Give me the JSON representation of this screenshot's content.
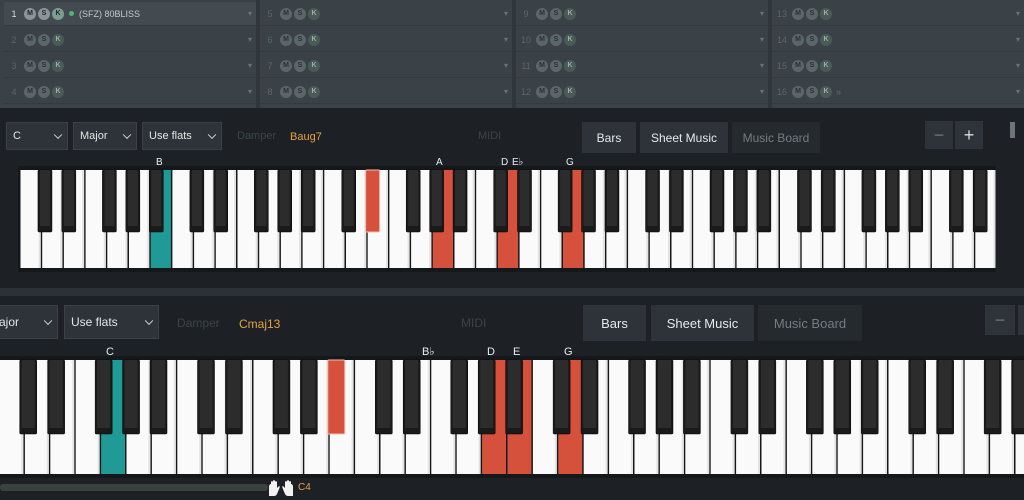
{
  "tracks": [
    {
      "num": "1",
      "name": "(SFZ) 80BLISS",
      "active": true
    },
    {
      "num": "2",
      "name": "",
      "active": false
    },
    {
      "num": "3",
      "name": "",
      "active": false
    },
    {
      "num": "4",
      "name": "",
      "active": false
    },
    {
      "num": "5",
      "name": "",
      "active": false
    },
    {
      "num": "6",
      "name": "",
      "active": false
    },
    {
      "num": "7",
      "name": "",
      "active": false
    },
    {
      "num": "8",
      "name": "",
      "active": false
    },
    {
      "num": "9",
      "name": "",
      "active": false
    },
    {
      "num": "10",
      "name": "",
      "active": false
    },
    {
      "num": "11",
      "name": "",
      "active": false
    },
    {
      "num": "12",
      "name": "",
      "active": false
    },
    {
      "num": "13",
      "name": "",
      "active": false
    },
    {
      "num": "14",
      "name": "",
      "active": false
    },
    {
      "num": "15",
      "name": "",
      "active": false
    },
    {
      "num": "16",
      "name": "»",
      "active": false
    }
  ],
  "track_buttons": {
    "mute": "M",
    "solo": "S",
    "key": "K",
    "dropdown": "▾"
  },
  "panel1": {
    "key_select": "C",
    "scale_select": "Major",
    "accidentals_select": "Use flats",
    "damper_label": "Damper",
    "chord_name": "Baug7",
    "midi_label": "MIDI",
    "tabs": [
      "Bars",
      "Sheet Music",
      "Music Board"
    ],
    "zoom_out": "−",
    "zoom_in": "+",
    "note_labels": [
      "B",
      "A",
      "D",
      "E♭",
      "G"
    ]
  },
  "panel2": {
    "scale_select": "ajor",
    "accidentals_select": "Use flats",
    "damper_label": "Damper",
    "chord_name": "Cmaj13",
    "midi_label": "MIDI",
    "tabs": [
      "Bars",
      "Sheet Music",
      "Music Board"
    ],
    "zoom_out": "−",
    "note_labels": [
      "C",
      "B♭",
      "D",
      "E",
      "G"
    ],
    "octave_label": "C4"
  },
  "colors": {
    "accent_teal": "#1f9a96",
    "accent_red": "#d6513c",
    "chord_text": "#e5a33c"
  }
}
